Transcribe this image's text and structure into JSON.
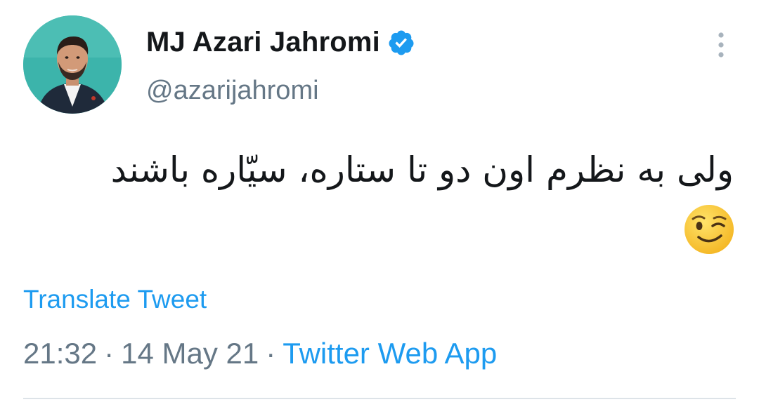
{
  "user": {
    "display_name": "MJ Azari Jahromi",
    "handle": "@azarijahromi",
    "verified": true,
    "verified_color": "#1d9bf0"
  },
  "tweet": {
    "text": "ولی به نظرم اون دو تا ستاره، سیّاره باشند",
    "emoji": "winking-face",
    "translate_label": "Translate Tweet",
    "time": "21:32",
    "date": "14 May 21",
    "separator": "·",
    "source": "Twitter Web App"
  },
  "colors": {
    "text": "#14171a",
    "secondary": "#657786",
    "link": "#1d9bf0",
    "divider": "#dde3e8"
  },
  "icons": {
    "more": "more-vertical-icon",
    "verified": "verified-badge-icon"
  }
}
